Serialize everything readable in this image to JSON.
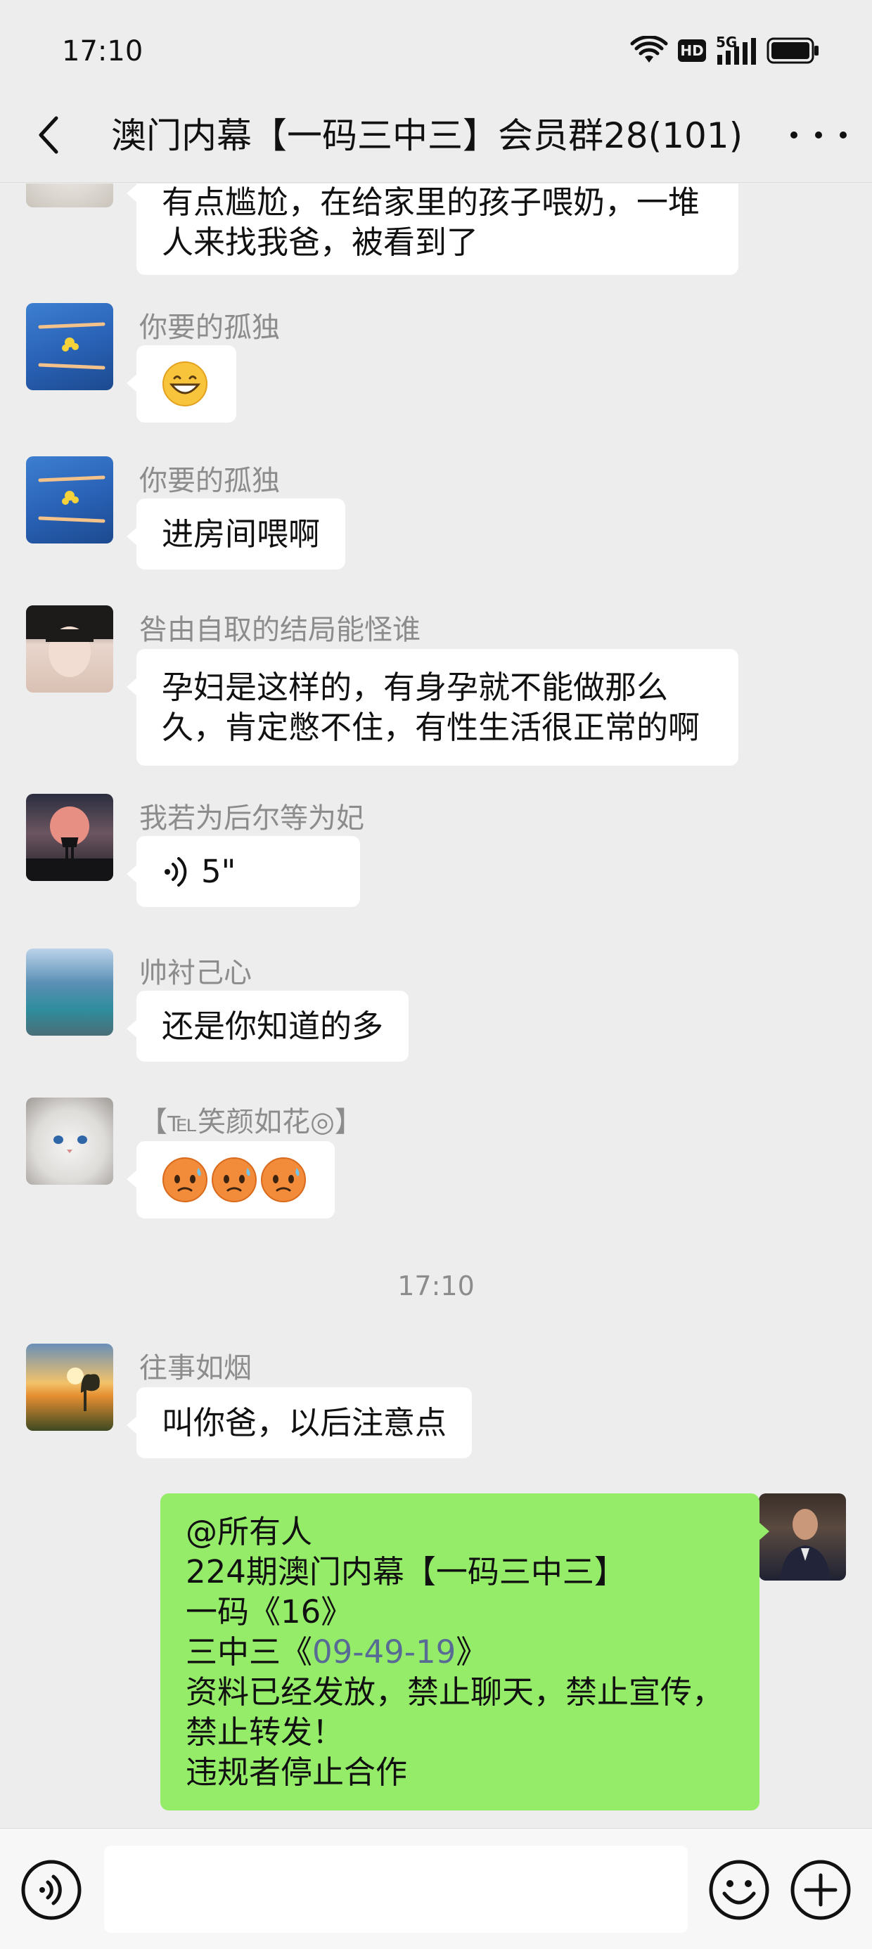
{
  "status_bar": {
    "time": "17:10",
    "network": "5G",
    "hd_badge": "HD",
    "icons": [
      "wifi-icon",
      "hd-icon",
      "signal-icon",
      "battery-icon"
    ]
  },
  "nav": {
    "title": "澳门内幕【一码三中三】会员群28(101)",
    "icons": [
      "back-icon",
      "more-icon"
    ]
  },
  "messages": [
    {
      "sender": "",
      "lines": [
        "有点尴尬，在给家里的孩子喂奶，一堆",
        "人来找我爸，被看到了"
      ]
    },
    {
      "sender": "你要的孤独",
      "emoji": "grinning-face"
    },
    {
      "sender": "你要的孤独",
      "lines": [
        "进房间喂啊"
      ]
    },
    {
      "sender": "咎由自取的结局能怪谁",
      "lines": [
        "孕妇是这样的，有身孕就不能做那么",
        "久，肯定憋不住，有性生活很正常的啊"
      ]
    },
    {
      "sender": "我若为后尔等为妃",
      "voice_duration": "5\""
    },
    {
      "sender": "帅衬己心",
      "lines": [
        "还是你知道的多"
      ]
    },
    {
      "sender": "【℡笑颜如花◎】",
      "emoji": "anxious-face-with-sweat x3"
    },
    {
      "sender": "往事如烟",
      "lines": [
        "叫你爸，以后注意点"
      ]
    }
  ],
  "timestamp": "17:10",
  "my_message": {
    "line1": "@所有人",
    "line2": "224期澳门内幕【一码三中三】",
    "line3": "一码《16》",
    "line4_prefix": "三中三《",
    "line4_link": "09-49-19",
    "line4_suffix": "》",
    "line5": "资料已经发放，禁止聊天，禁止宣传，",
    "line6": "禁止转发！",
    "line7": "违规者停止合作"
  },
  "input_bar": {
    "placeholder": "",
    "icons": [
      "voice-icon",
      "emoji-icon",
      "plus-icon"
    ]
  },
  "colors": {
    "background": "#ededed",
    "my_bubble": "#95ec69",
    "other_bubble": "#ffffff",
    "link": "#576b95",
    "sender_name": "#8c8c8c"
  }
}
